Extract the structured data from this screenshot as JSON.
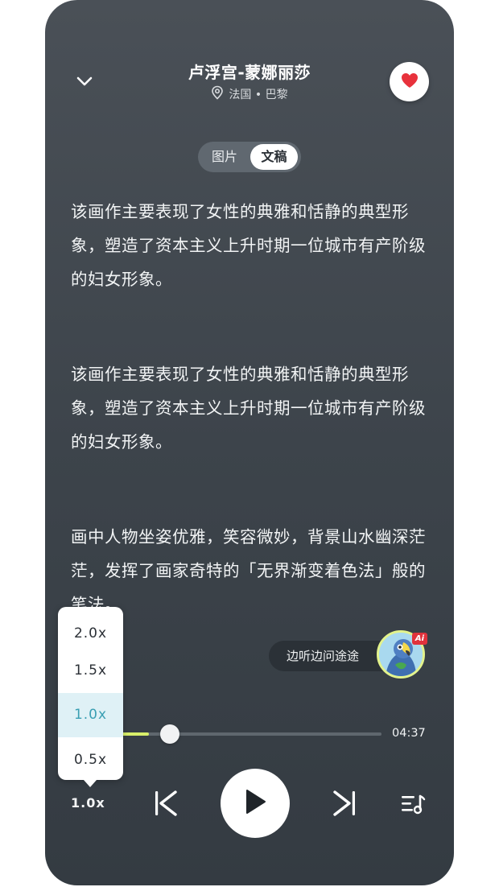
{
  "header": {
    "title": "卢浮宫-蒙娜丽莎",
    "location": "法国 • 巴黎"
  },
  "tabs": [
    {
      "label": "图片",
      "selected": false
    },
    {
      "label": "文稿",
      "selected": true
    }
  ],
  "transcript": {
    "paragraphs": [
      "该画作主要表现了女性的典雅和恬静的典型形象，塑造了资本主义上升时期一位城市有产阶级的妇女形象。",
      "该画作主要表现了女性的典雅和恬静的典型形象，塑造了资本主义上升时期一位城市有产阶级的妇女形象。",
      "画中人物坐姿优雅，笑容微妙，背景山水幽深茫茫，发挥了画家奇特的「无界渐变着色法」般的笔法。"
    ]
  },
  "ai_assistant": {
    "label": "边听边问途途",
    "badge": "Ai"
  },
  "player": {
    "progress": 0.18,
    "duration": "04:37",
    "speed_label": "1.0x",
    "speed_options": [
      {
        "label": "2.0x",
        "selected": false
      },
      {
        "label": "1.5x",
        "selected": false
      },
      {
        "label": "1.0x",
        "selected": true
      },
      {
        "label": "0.5x",
        "selected": false
      }
    ]
  },
  "colors": {
    "accent_progress": "#d8ef6a",
    "favorite": "#e8323c",
    "speed_selected": "#3a9fb3"
  },
  "icons": [
    "chevron-down-icon",
    "location-pin-icon",
    "heart-icon",
    "previous-icon",
    "play-icon",
    "next-icon",
    "playlist-icon"
  ]
}
